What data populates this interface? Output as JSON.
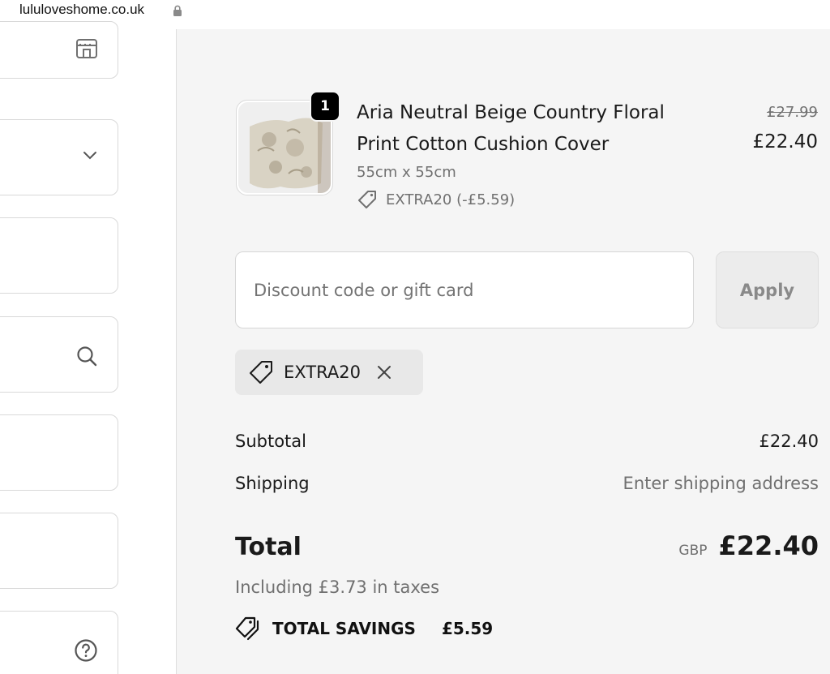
{
  "browser": {
    "url": "lululoveshome.co.uk",
    "icon": "lock-icon"
  },
  "left_form": {
    "icons": [
      "store-icon",
      "chevron-down-icon",
      "search-icon",
      "help-circle-icon"
    ]
  },
  "product": {
    "title": "Aria Neutral Beige Country Floral Print Cotton Cushion Cover",
    "variant": "55cm x 55cm",
    "discount_line": "EXTRA20 (-£5.59)",
    "quantity": "1",
    "price_original": "£27.99",
    "price_current": "£22.40",
    "image": "cushion-image"
  },
  "discount": {
    "placeholder": "Discount code or gift card",
    "value": "",
    "apply_label": "Apply",
    "applied_code": "EXTRA20"
  },
  "summary": {
    "subtotal_label": "Subtotal",
    "subtotal_value": "£22.40",
    "shipping_label": "Shipping",
    "shipping_value": "Enter shipping address",
    "total_label": "Total",
    "currency": "GBP",
    "total_value": "£22.40",
    "taxes_text": "Including £3.73 in taxes",
    "savings_label": "TOTAL SAVINGS",
    "savings_value": "£5.59"
  },
  "colors": {
    "background": "#f5f5f5",
    "accent_text": "#1a1a1a",
    "muted_text": "#707070",
    "badge": "#000000"
  }
}
